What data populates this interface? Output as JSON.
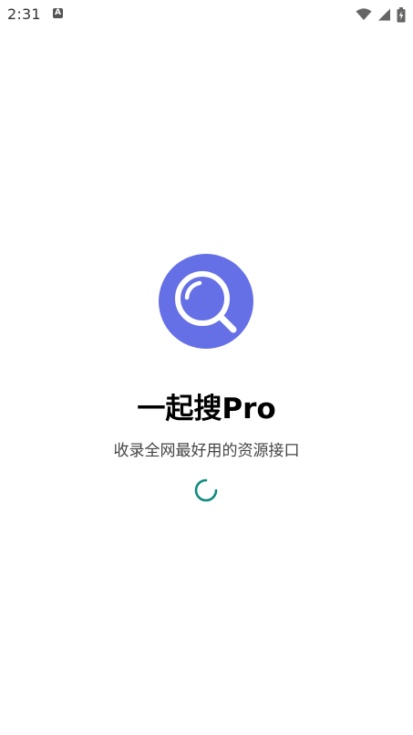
{
  "status_bar": {
    "time": "2:31",
    "notification_icon": "a-icon",
    "wifi_icon": "wifi-icon",
    "signal_icon": "signal-icon",
    "battery_icon": "battery-charging-icon"
  },
  "splash": {
    "logo_icon": "magnifier-icon",
    "title": "一起搜Pro",
    "subtitle": "收录全网最好用的资源接口",
    "loading_icon": "spinner-icon"
  },
  "colors": {
    "logo_bg": "#6670E6",
    "logo_stroke": "#FFFFFF",
    "spinner": "#0E8A7E",
    "title": "#000000",
    "subtitle": "#444444"
  }
}
